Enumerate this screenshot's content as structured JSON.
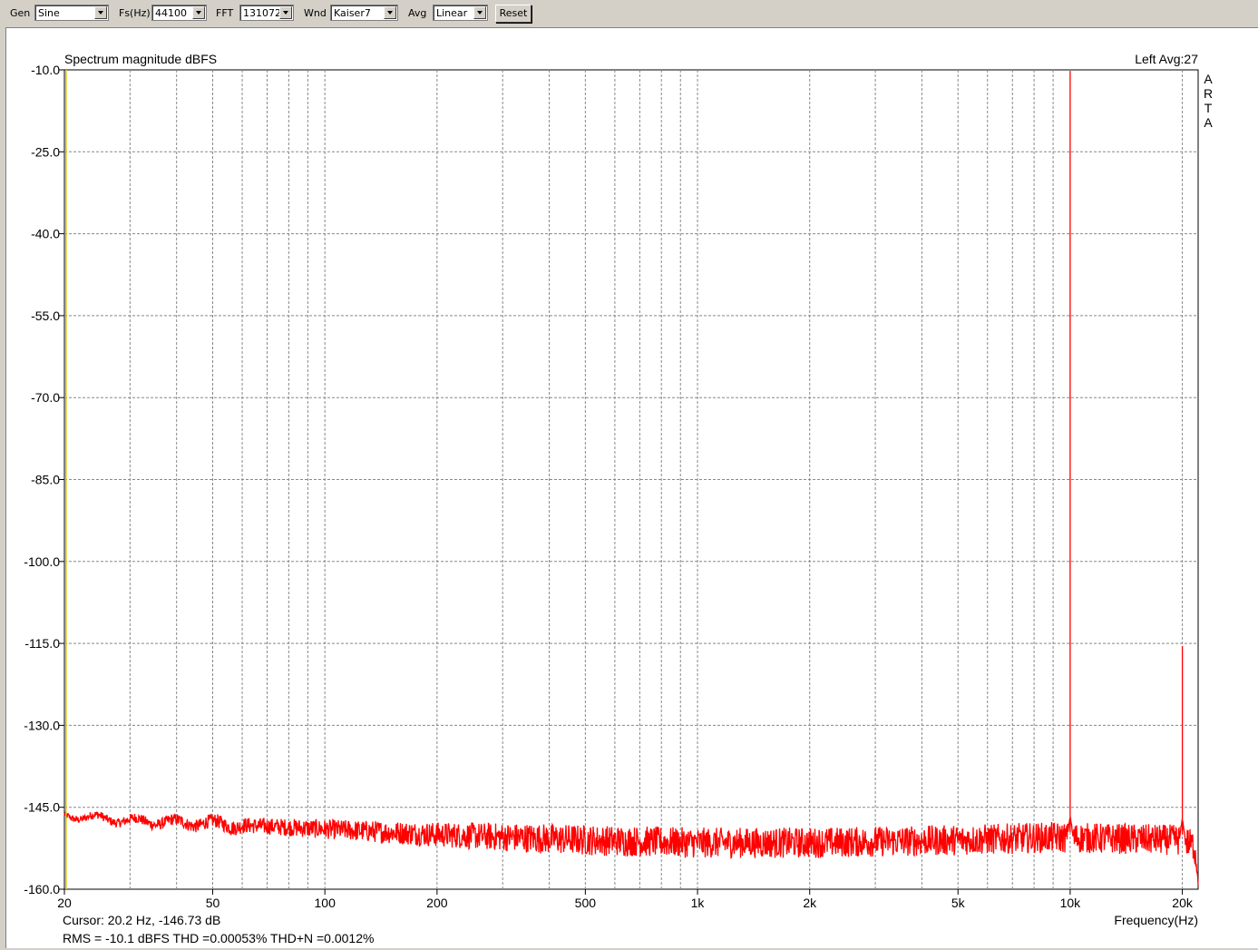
{
  "toolbar": {
    "gen_label": "Gen",
    "gen_value": "Sine",
    "fs_label": "Fs(Hz)",
    "fs_value": "44100",
    "fft_label": "FFT",
    "fft_value": "131072",
    "wnd_label": "Wnd",
    "wnd_value": "Kaiser7",
    "avg_label": "Avg",
    "avg_value": "Linear",
    "reset_label": "Reset"
  },
  "chart_data": {
    "type": "line",
    "title": "Spectrum magnitude dBFS",
    "top_right": "Left  Avg:27",
    "side_letters": [
      "A",
      "R",
      "T",
      "A"
    ],
    "xlabel": "Frequency(Hz)",
    "ylabel": "",
    "x_scale": "log",
    "xlim": [
      20,
      22050
    ],
    "ylim": [
      -160,
      -10
    ],
    "grid": true,
    "yticks": [
      -10,
      -25,
      -40,
      -55,
      -70,
      -85,
      -100,
      -115,
      -130,
      -145,
      -160
    ],
    "ytick_labels": [
      "-10.0",
      "-25.0",
      "-40.0",
      "-55.0",
      "-70.0",
      "-85.0",
      "-100.0",
      "-115.0",
      "-130.0",
      "-145.0",
      "-160.0"
    ],
    "xticks": [
      20,
      50,
      100,
      200,
      500,
      1000,
      2000,
      5000,
      10000,
      20000
    ],
    "xtick_labels": [
      "20",
      "50",
      "100",
      "200",
      "500",
      "1k",
      "2k",
      "5k",
      "10k",
      "20k"
    ],
    "series": [
      {
        "color": "#ff0000",
        "noise_floor": [
          [
            20,
            -146.5
          ],
          [
            25,
            -147
          ],
          [
            30,
            -147.5
          ],
          [
            50,
            -148
          ],
          [
            100,
            -149
          ],
          [
            200,
            -150
          ],
          [
            500,
            -151
          ],
          [
            1000,
            -151.5
          ],
          [
            2000,
            -151.5
          ],
          [
            5000,
            -151
          ],
          [
            9000,
            -150.5
          ],
          [
            20000,
            -151
          ],
          [
            21500,
            -152
          ],
          [
            22050,
            -157
          ]
        ],
        "peaks": [
          {
            "x": 10000,
            "y": -10.2
          },
          {
            "x": 20000,
            "y": -115.5
          }
        ]
      }
    ],
    "cursor_marker_x": 20.2,
    "cursor_marker_color": "#e0c000"
  },
  "status": {
    "cursor": "Cursor:    20.2 Hz, -146.73 dB",
    "measurements": "RMS =  -10.1 dBFS   THD =0.00053%   THD+N =0.0012%",
    "measure_color": "#c00000"
  }
}
